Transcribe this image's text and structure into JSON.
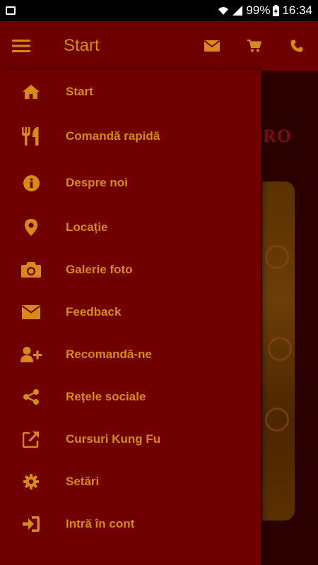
{
  "status_bar": {
    "battery": "99%",
    "time": "16:34"
  },
  "app_bar": {
    "title": "Start"
  },
  "background": {
    "logo_text": "RO"
  },
  "drawer": {
    "items": [
      {
        "label": "Start",
        "icon": "home-icon"
      },
      {
        "label": "Comandă rapidă",
        "icon": "fork-knife-icon"
      },
      {
        "label": "Despre noi",
        "icon": "info-icon"
      },
      {
        "label": "Locație",
        "icon": "location-pin-icon"
      },
      {
        "label": "Galerie foto",
        "icon": "camera-icon"
      },
      {
        "label": "Feedback",
        "icon": "envelope-icon"
      },
      {
        "label": "Recomandă-ne",
        "icon": "add-user-icon"
      },
      {
        "label": "Rețele sociale",
        "icon": "share-icon"
      },
      {
        "label": "Cursuri Kung Fu",
        "icon": "external-link-icon"
      },
      {
        "label": "Setări",
        "icon": "gear-icon"
      },
      {
        "label": "Intră în cont",
        "icon": "sign-in-icon"
      }
    ]
  },
  "colors": {
    "accent": "#d58a1a",
    "app_bar": "#6e0000",
    "drawer": "#700000",
    "status_bar": "#000000"
  }
}
